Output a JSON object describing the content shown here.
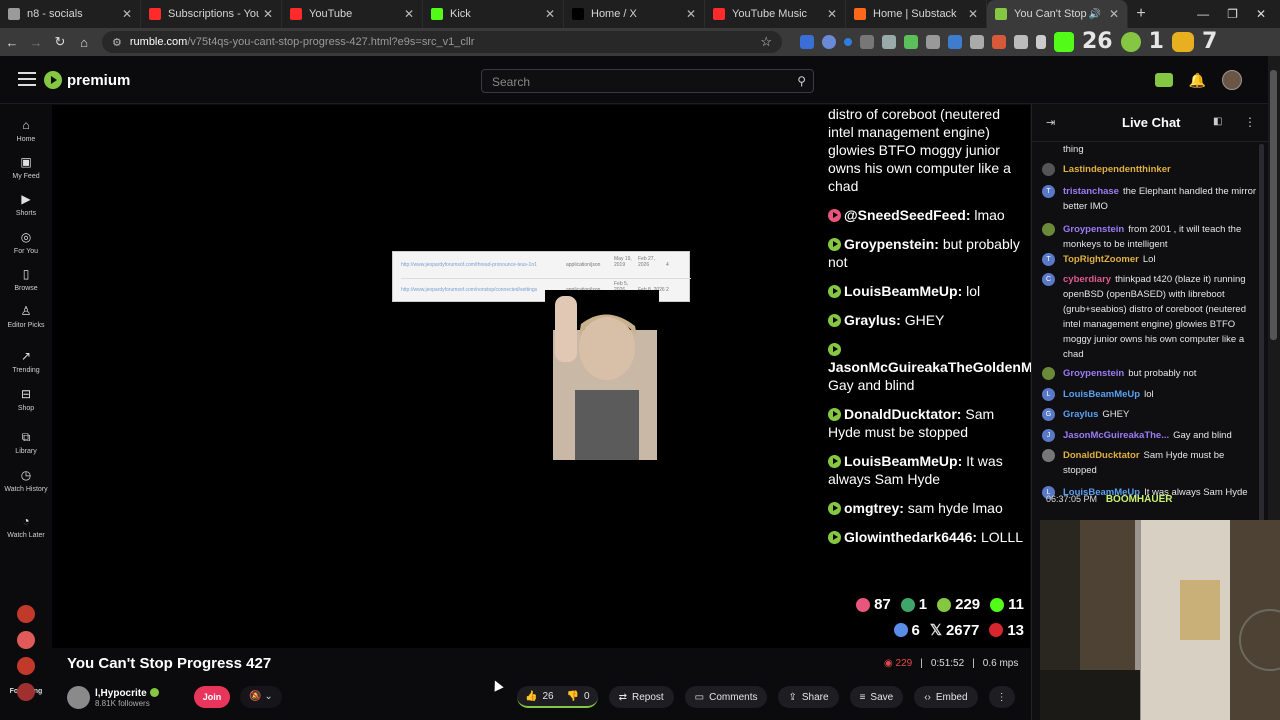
{
  "browser": {
    "tabs": [
      {
        "title": "n8 - socials",
        "color": "#9a9a9a"
      },
      {
        "title": "Subscriptions - YouTube",
        "color": "#ff2a2a"
      },
      {
        "title": "YouTube",
        "color": "#ff2a2a"
      },
      {
        "title": "Kick",
        "color": "#53fc18"
      },
      {
        "title": "Home / X",
        "color": "#000000"
      },
      {
        "title": "YouTube Music",
        "color": "#ff2a2a"
      },
      {
        "title": "Home | Substack",
        "color": "#ff6719"
      },
      {
        "title": "You Can't Stop Progre",
        "color": "#85c742",
        "active": true
      }
    ],
    "url_host": "rumble.com",
    "url_path": "/v75t4qs-you-cant-stop-progress-427.html?e9s=src_v1_cllr",
    "counter_a": "26",
    "counter_b": "1",
    "counter_c": "7"
  },
  "header": {
    "logo_text": "premium",
    "search_placeholder": "Search"
  },
  "sidebar": {
    "items": [
      {
        "label": "Home",
        "icon": "home-icon",
        "glyph": "⌂"
      },
      {
        "label": "My Feed",
        "icon": "feed-icon",
        "glyph": "▣"
      },
      {
        "label": "Shorts",
        "icon": "shorts-icon",
        "glyph": "▶"
      },
      {
        "label": "For You",
        "icon": "target-icon",
        "glyph": "◎"
      },
      {
        "label": "Browse",
        "icon": "browse-icon",
        "glyph": "▯"
      },
      {
        "label": "Editor Picks",
        "icon": "editor-picks-icon",
        "glyph": "♙"
      },
      {
        "label": "Trending",
        "icon": "trending-icon",
        "glyph": "↗"
      },
      {
        "label": "Shop",
        "icon": "shop-icon",
        "glyph": "⊟"
      },
      {
        "label": "Library",
        "icon": "library-icon",
        "glyph": "⧉"
      },
      {
        "label": "Watch History",
        "icon": "history-icon",
        "glyph": "◷"
      },
      {
        "label": "Watch Later",
        "icon": "clock-icon",
        "glyph": "◔"
      }
    ],
    "following_label": "Following",
    "following_colors": [
      "#c0392b",
      "#e05a5a",
      "#c0392b",
      "#a03030"
    ]
  },
  "video": {
    "overlay_chat": [
      {
        "user": "",
        "text": "distro of coreboot (neutered intel management engine) glowies BTFO moggy junior owns his own computer like a chad",
        "icon": ""
      },
      {
        "user": "@SneedSeedFeed",
        "text": "lmao",
        "icon": "pink"
      },
      {
        "user": "Groypenstein",
        "text": "but probably not",
        "icon": "green"
      },
      {
        "user": "LouisBeamMeUp",
        "text": "lol",
        "icon": "green"
      },
      {
        "user": "Graylus",
        "text": "GHEY",
        "icon": "green"
      },
      {
        "user": "JasonMcGuireakaTheGoldenMan",
        "text": "Gay and blind",
        "icon": "green"
      },
      {
        "user": "DonaldDucktator",
        "text": "Sam Hyde must be stopped",
        "icon": "green"
      },
      {
        "user": "LouisBeamMeUp",
        "text": "It was always Sam Hyde",
        "icon": "green"
      },
      {
        "user": "omgtrey",
        "text": "sam hyde lmao",
        "icon": "green"
      },
      {
        "user": "Glowinthedark6446",
        "text": "LOLLL",
        "icon": "green"
      }
    ],
    "stats": [
      {
        "value": "87",
        "color": "#e8557d"
      },
      {
        "value": "1",
        "color": "#3fa56b"
      },
      {
        "value": "229",
        "color": "#85c742"
      },
      {
        "value": "11",
        "color": "#53fc18"
      },
      {
        "value": "6",
        "color": "#5a8de8"
      },
      {
        "value": "2677",
        "color": "#dddddd",
        "glyph": "𝕏"
      },
      {
        "value": "13",
        "color": "#d8262f"
      }
    ],
    "browser_rows": [
      {
        "link": "http://www.jeopardyforumsof.com/thread-pronounce-teus-1n1",
        "type": "application/json",
        "date": "May 19, 2019",
        "mod": "Feb 27, 2026",
        "n": "4"
      },
      {
        "link": "http://www.jeopardyforumsof.com/nonstop/connected/settings",
        "type": "application/json",
        "date": "Feb 5, 2026",
        "mod": "Feb 8, 2026",
        "n": "2"
      }
    ]
  },
  "details": {
    "title": "You Can't Stop Progress 427",
    "viewers": "229",
    "duration": "0:51:52",
    "rate": "0.6 mps",
    "channel_name": "l,Hypocrite",
    "followers": "8.81K followers",
    "join_label": "Join",
    "likes": "26",
    "dislikes": "0",
    "repost_label": "Repost",
    "comments_label": "Comments",
    "share_label": "Share",
    "save_label": "Save",
    "embed_label": "Embed"
  },
  "chat": {
    "title": "Live Chat",
    "messages": [
      {
        "user": "",
        "text": "thing",
        "color": "#e6e6e6",
        "avatar": "",
        "avcolor": ""
      },
      {
        "user": "Lastindependentthinker",
        "text": "",
        "color": "#e0b040",
        "avatar": "",
        "avcolor": "#555"
      },
      {
        "user": "tristanchase",
        "text": "the Elephant handled the mirror better IMO",
        "color": "#9c7cf4",
        "avatar": "T",
        "avcolor": "#5a78c8"
      },
      {
        "user": "Groypenstein",
        "text": "from 2001 , it will teach the monkeys to be intelligent",
        "color": "#9c7cf4",
        "avatar": "",
        "avcolor": "#6a8a3a"
      },
      {
        "user": "TopRightZoomer",
        "text": "Lol",
        "color": "#e0b040",
        "avatar": "T",
        "avcolor": "#5a78c8"
      },
      {
        "user": "cyberdiary",
        "text": "thinkpad t420 (blaze it) running openBSD (openBASED) with libreboot (grub+seabios) distro of coreboot (neutered intel management engine) glowies BTFO moggy junior owns his own computer like a chad",
        "color": "#e05a8a",
        "avatar": "C",
        "avcolor": "#5a78c8"
      },
      {
        "user": "Groypenstein",
        "text": "but probably not",
        "color": "#9c7cf4",
        "avatar": "",
        "avcolor": "#6a8a3a"
      },
      {
        "user": "LouisBeamMeUp",
        "text": "lol",
        "color": "#5aa0f0",
        "avatar": "L",
        "avcolor": "#5a78c8"
      },
      {
        "user": "Graylus",
        "text": "GHEY",
        "color": "#5aa0f0",
        "avatar": "G",
        "avcolor": "#5a78c8"
      },
      {
        "user": "JasonMcGuireakaThe...",
        "text": "Gay and blind",
        "color": "#9c7cf4",
        "avatar": "J",
        "avcolor": "#5a78c8"
      },
      {
        "user": "DonaldDucktator",
        "text": "Sam Hyde must be stopped",
        "color": "#e0b040",
        "avatar": "",
        "avcolor": "#777"
      },
      {
        "user": "LouisBeamMeUp",
        "text": "It was always Sam Hyde",
        "color": "#5aa0f0",
        "avatar": "L",
        "avcolor": "#5a78c8"
      }
    ],
    "webcam_overlay": "BOOMHAUER",
    "webcam_time": "06:37:05 PM"
  }
}
